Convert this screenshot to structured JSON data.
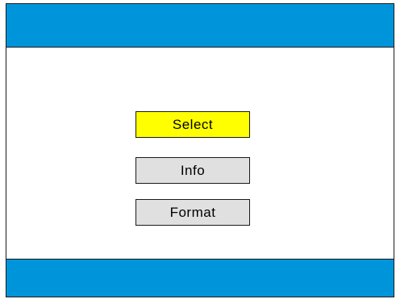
{
  "colors": {
    "bar": "#0095db",
    "selected": "#ffff00",
    "button": "#e0e0e0"
  },
  "menu": {
    "selected_index": 0,
    "items": [
      {
        "label": "Select"
      },
      {
        "label": "Info"
      },
      {
        "label": "Format"
      }
    ]
  }
}
